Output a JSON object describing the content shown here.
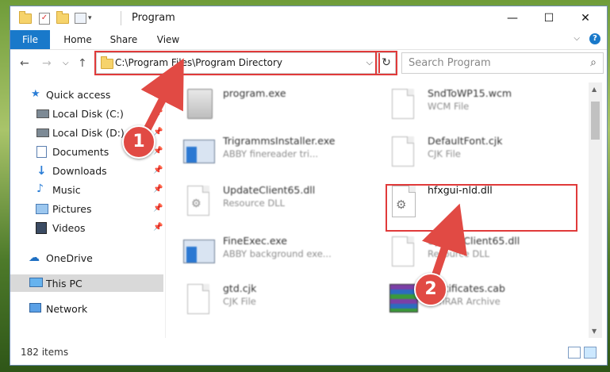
{
  "window": {
    "title": "Program",
    "minimize": "—",
    "maximize": "☐",
    "close": "✕"
  },
  "ribbon": {
    "tabs": [
      "File",
      "Home",
      "Share",
      "View"
    ],
    "help": "?",
    "collapse": "⌵"
  },
  "nav": {
    "back": "←",
    "forward": "→",
    "recent": "⌵",
    "up": "↑",
    "address": "C:\\Program Files\\Program Directory",
    "refresh": "↻",
    "search_placeholder": "Search Program",
    "search_icon": "search-icon"
  },
  "sidebar": {
    "items": [
      {
        "label": "Quick access",
        "icon": "star-icon",
        "pinned": false
      },
      {
        "label": "Local Disk (C:)",
        "icon": "drive-icon",
        "pinned": true
      },
      {
        "label": "Local Disk (D:)",
        "icon": "drive-icon",
        "pinned": true
      },
      {
        "label": "Documents",
        "icon": "documents-icon",
        "pinned": true
      },
      {
        "label": "Downloads",
        "icon": "download-arrow-icon",
        "pinned": true
      },
      {
        "label": "Music",
        "icon": "music-note-icon",
        "pinned": true
      },
      {
        "label": "Pictures",
        "icon": "pictures-icon",
        "pinned": true
      },
      {
        "label": "Videos",
        "icon": "film-icon",
        "pinned": true
      },
      {
        "label": "OneDrive",
        "icon": "cloud-icon",
        "pinned": false
      },
      {
        "label": "This PC",
        "icon": "monitor-icon",
        "pinned": false,
        "selected": true
      },
      {
        "label": "Network",
        "icon": "network-icon",
        "pinned": false
      }
    ],
    "pin_glyph": "📌"
  },
  "files": [
    {
      "name": "program.exe",
      "type": "",
      "icon": "installer-icon"
    },
    {
      "name": "SndToWP15.wcm",
      "type": "WCM File",
      "icon": "document-icon"
    },
    {
      "name": "TrigrammsInstaller.exe",
      "type": "ABBY finereader tri...",
      "icon": "application-icon"
    },
    {
      "name": "DefaultFont.cjk",
      "type": "CJK File",
      "icon": "document-icon"
    },
    {
      "name": "UpdateClient65.dll",
      "type": "Resource DLL",
      "icon": "dll-gear-icon"
    },
    {
      "name": "hfxgui-nld.dll",
      "type": "",
      "icon": "dll-gear-icon",
      "highlighted": true
    },
    {
      "name": "FineExec.exe",
      "type": "ABBY background exe...",
      "icon": "application-icon"
    },
    {
      "name": "UpdateClient65.dll",
      "type": "Resource DLL",
      "icon": "document-icon"
    },
    {
      "name": "gtd.cjk",
      "type": "CJK File",
      "icon": "document-icon"
    },
    {
      "name": "Certificates.cab",
      "type": "WinRAR Archive",
      "icon": "winrar-archive-icon"
    }
  ],
  "status": {
    "items": "182 items"
  },
  "callouts": [
    "1",
    "2"
  ],
  "colors": {
    "accent": "#1979ca",
    "highlight": "#e03a3a",
    "selected_bg": "#cce8ff"
  }
}
